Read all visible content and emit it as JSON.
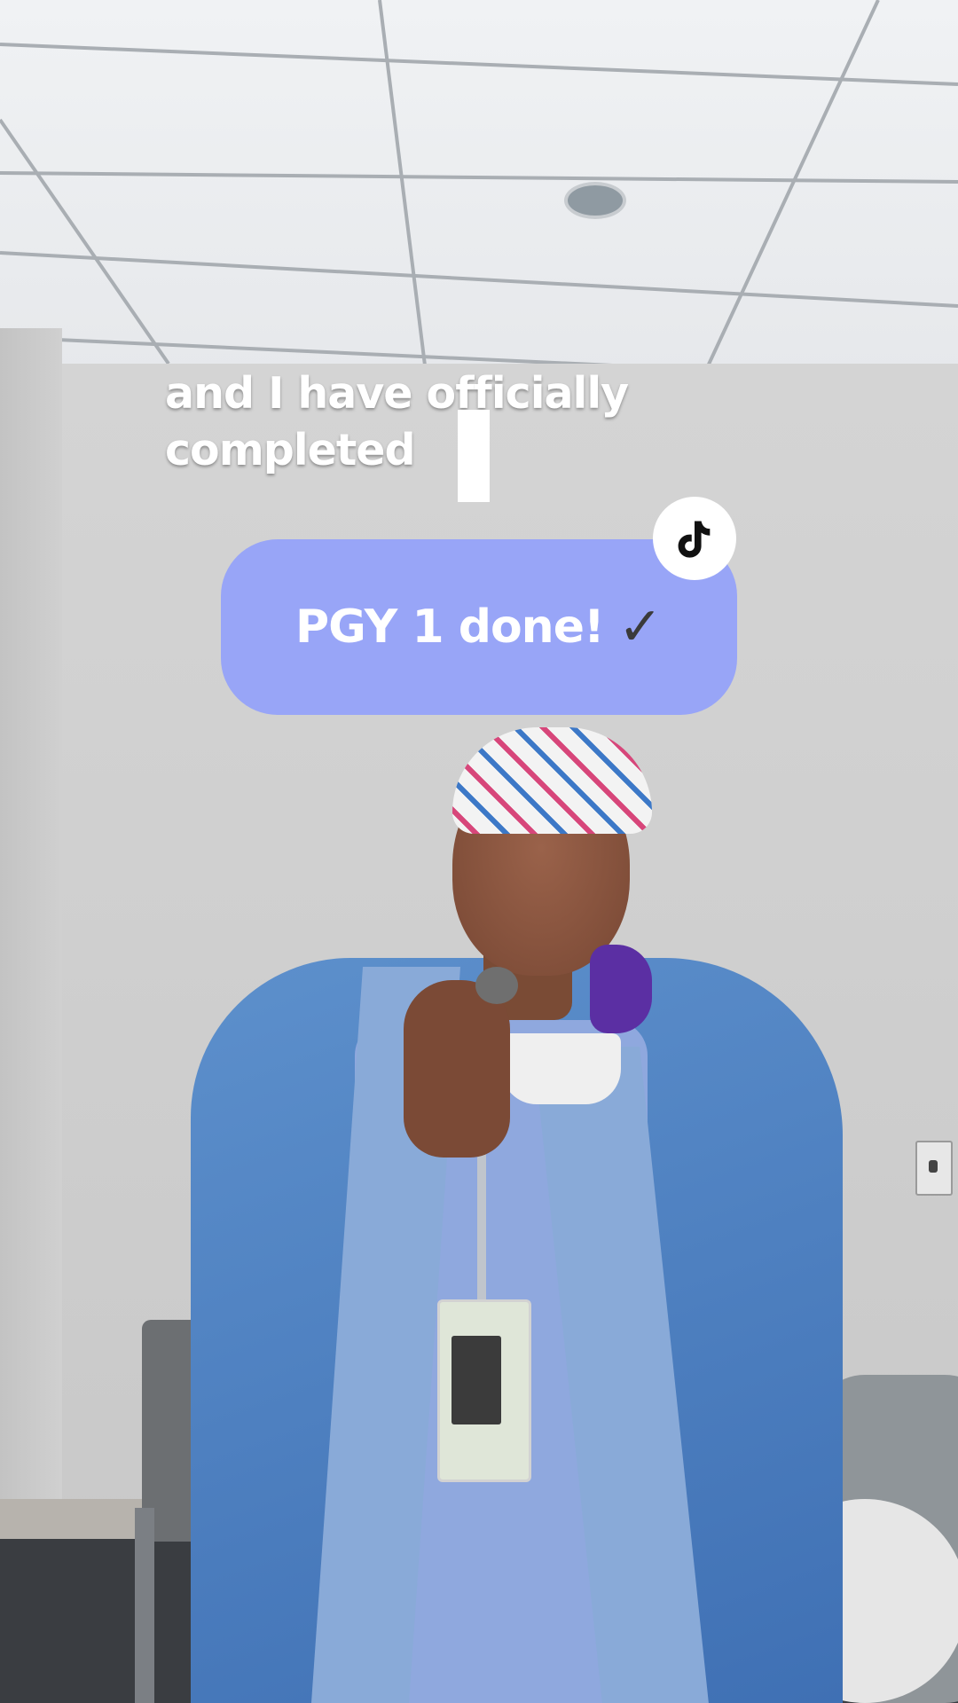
{
  "caption": {
    "line1": "and I have officially",
    "line2": "completed"
  },
  "sticker": {
    "text": "PGY 1 done!",
    "check": "✓",
    "background_color": "#98a5f7"
  },
  "brand": {
    "icon": "tiktok-logo-icon"
  }
}
